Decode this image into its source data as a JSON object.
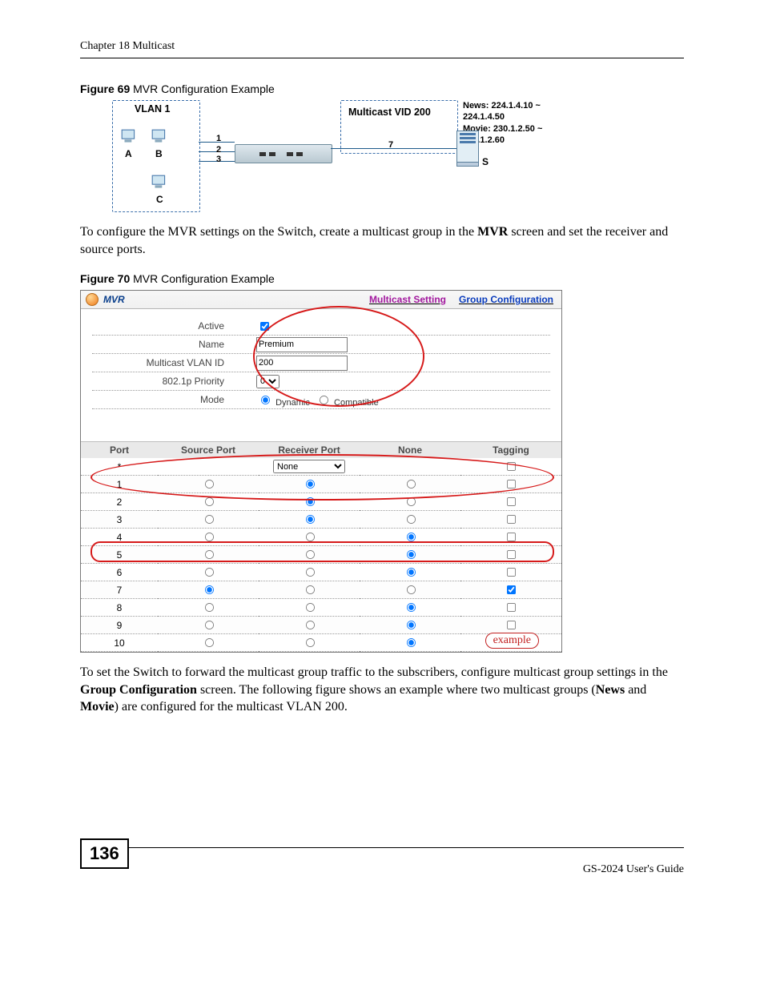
{
  "header": {
    "chapter": "Chapter 18 Multicast"
  },
  "fig69": {
    "caption_bold": "Figure 69",
    "caption_rest": "   MVR Configuration Example",
    "vlan_label": "VLAN 1",
    "vid_label": "Multicast VID 200",
    "hosts": {
      "a": "A",
      "b": "B",
      "c": "C",
      "s": "S"
    },
    "wires": {
      "w1": "1",
      "w2": "2",
      "w3": "3",
      "w7": "7"
    },
    "ips_line1": "News: 224.1.4.10 ~ 224.1.4.50",
    "ips_line2": "Movie: 230.1.2.50 ~ 230.1.2.60"
  },
  "para1_pre": "To configure the MVR settings on the Switch, create a multicast group in the ",
  "para1_b1": "MVR",
  "para1_post": " screen and set the receiver and source ports.",
  "fig70": {
    "caption_bold": "Figure 70",
    "caption_rest": "   MVR Configuration Example",
    "title": "MVR",
    "link_ms": "Multicast Setting",
    "link_gc": "Group Configuration",
    "labels": {
      "active": "Active",
      "name": "Name",
      "mvid": "Multicast VLAN ID",
      "priority": "802.1p Priority",
      "mode": "Mode",
      "mode_dyn": "Dynamic",
      "mode_comp": "Compatible"
    },
    "values": {
      "name": "Premium",
      "mvid": "200",
      "priority": "0"
    },
    "cols": {
      "port": "Port",
      "src": "Source Port",
      "rcv": "Receiver Port",
      "none": "None",
      "tag": "Tagging"
    },
    "star": "*",
    "star_sel": "None",
    "rows": [
      {
        "port": "1",
        "sel": "rcv",
        "tag": false
      },
      {
        "port": "2",
        "sel": "rcv",
        "tag": false
      },
      {
        "port": "3",
        "sel": "rcv",
        "tag": false
      },
      {
        "port": "4",
        "sel": "none",
        "tag": false
      },
      {
        "port": "5",
        "sel": "none",
        "tag": false
      },
      {
        "port": "6",
        "sel": "none",
        "tag": false
      },
      {
        "port": "7",
        "sel": "src",
        "tag": true
      },
      {
        "port": "8",
        "sel": "none",
        "tag": false
      },
      {
        "port": "9",
        "sel": "none",
        "tag": false
      },
      {
        "port": "10",
        "sel": "none",
        "tag": false
      }
    ],
    "example": "example"
  },
  "para2_a": "To set the Switch to forward the multicast group traffic to the subscribers, configure multicast group settings in the ",
  "para2_b1": "Group Configuration",
  "para2_b": " screen. The following figure shows an example where two multicast groups (",
  "para2_b2": "News",
  "para2_c": " and ",
  "para2_b3": "Movie",
  "para2_d": ") are configured for the multicast VLAN 200.",
  "footer": {
    "page": "136",
    "guide": "GS-2024 User's Guide"
  }
}
